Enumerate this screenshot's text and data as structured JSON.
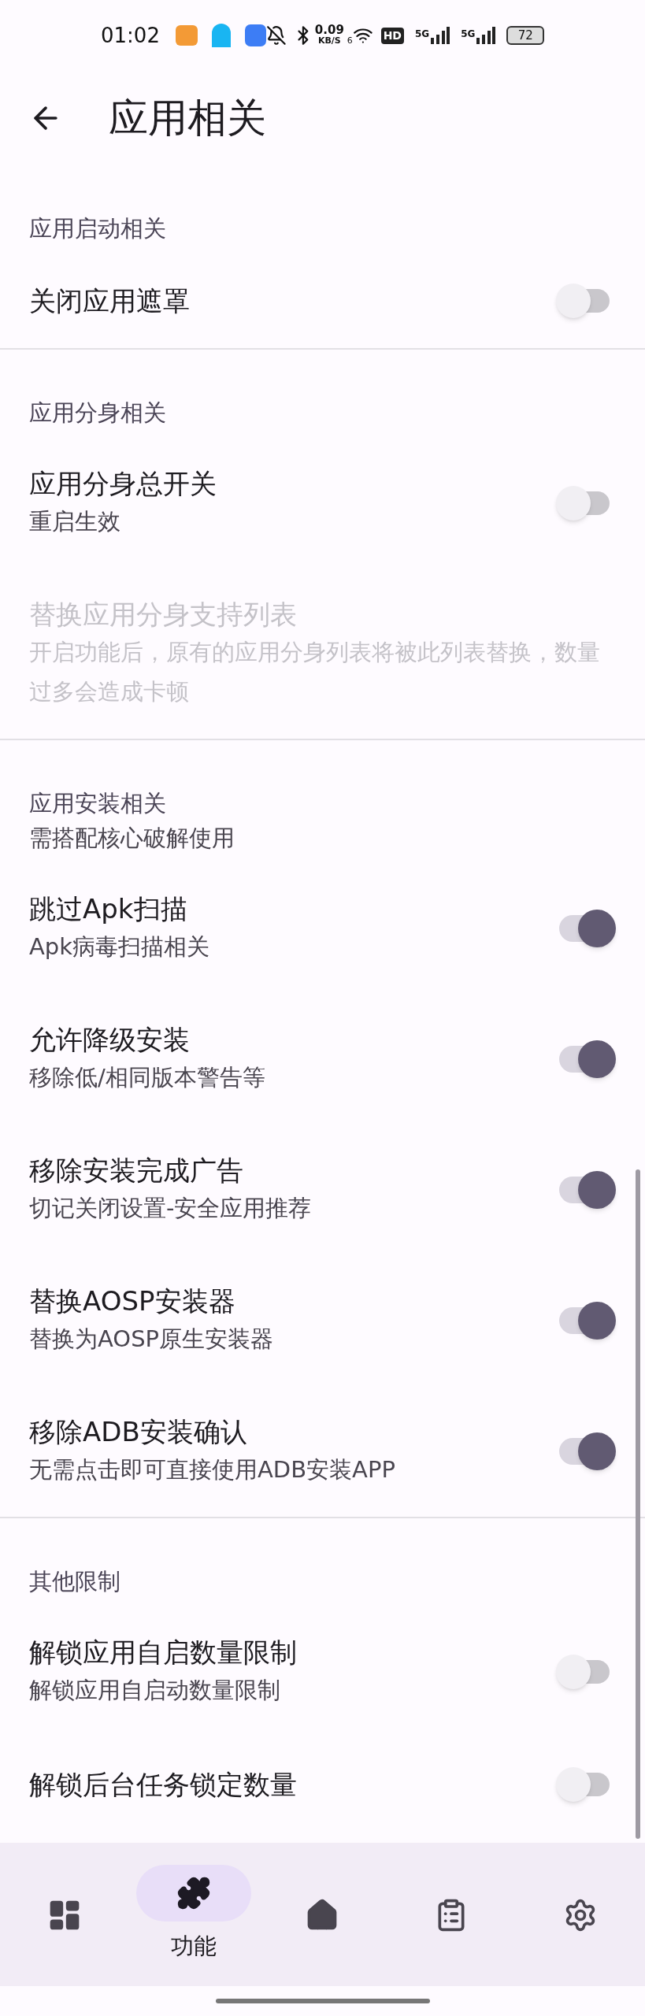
{
  "status_bar": {
    "time": "01:02",
    "speed_value": "0.09",
    "speed_unit": "KB/S",
    "wifi_label": "6",
    "hd": "HD",
    "signals": [
      "5G",
      "5G"
    ],
    "battery": "72"
  },
  "header": {
    "title": "应用相关"
  },
  "sections": [
    {
      "title": "应用启动相关",
      "items": [
        {
          "kind": "switch",
          "title": "关闭应用遮罩",
          "on": false,
          "disabled": false
        }
      ]
    },
    {
      "title": "应用分身相关",
      "items": [
        {
          "kind": "switch",
          "title": "应用分身总开关",
          "subtitle": "重启生效",
          "on": false,
          "disabled": false
        },
        {
          "kind": "text",
          "title": "替换应用分身支持列表",
          "subtitle": "开启功能后，原有的应用分身列表将被此列表替换，数量过多会造成卡顿",
          "disabled": true
        }
      ]
    },
    {
      "title": "应用安装相关",
      "subtitle": "需搭配核心破解使用",
      "items": [
        {
          "kind": "switch",
          "title": "跳过Apk扫描",
          "subtitle": "Apk病毒扫描相关",
          "on": true,
          "disabled": false
        },
        {
          "kind": "switch",
          "title": "允许降级安装",
          "subtitle": "移除低/相同版本警告等",
          "on": true,
          "disabled": false
        },
        {
          "kind": "switch",
          "title": "移除安装完成广告",
          "subtitle": "切记关闭设置-安全应用推荐",
          "on": true,
          "disabled": false
        },
        {
          "kind": "switch",
          "title": "替换AOSP安装器",
          "subtitle": "替换为AOSP原生安装器",
          "on": true,
          "disabled": false
        },
        {
          "kind": "switch",
          "title": "移除ADB安装确认",
          "subtitle": "无需点击即可直接使用ADB安装APP",
          "on": true,
          "disabled": false
        }
      ]
    },
    {
      "title": "其他限制",
      "items": [
        {
          "kind": "switch",
          "title": "解锁应用自启数量限制",
          "subtitle": "解锁应用自启动数量限制",
          "on": false,
          "disabled": false
        },
        {
          "kind": "switch",
          "title": "解锁后台任务锁定数量",
          "on": false,
          "disabled": false
        }
      ]
    }
  ],
  "nav": [
    {
      "kind": "dashboard",
      "selected": false
    },
    {
      "kind": "puzzle",
      "label": "功能",
      "selected": true
    },
    {
      "kind": "home",
      "selected": false
    },
    {
      "kind": "clipboard",
      "selected": false
    },
    {
      "kind": "settings",
      "selected": false
    }
  ]
}
